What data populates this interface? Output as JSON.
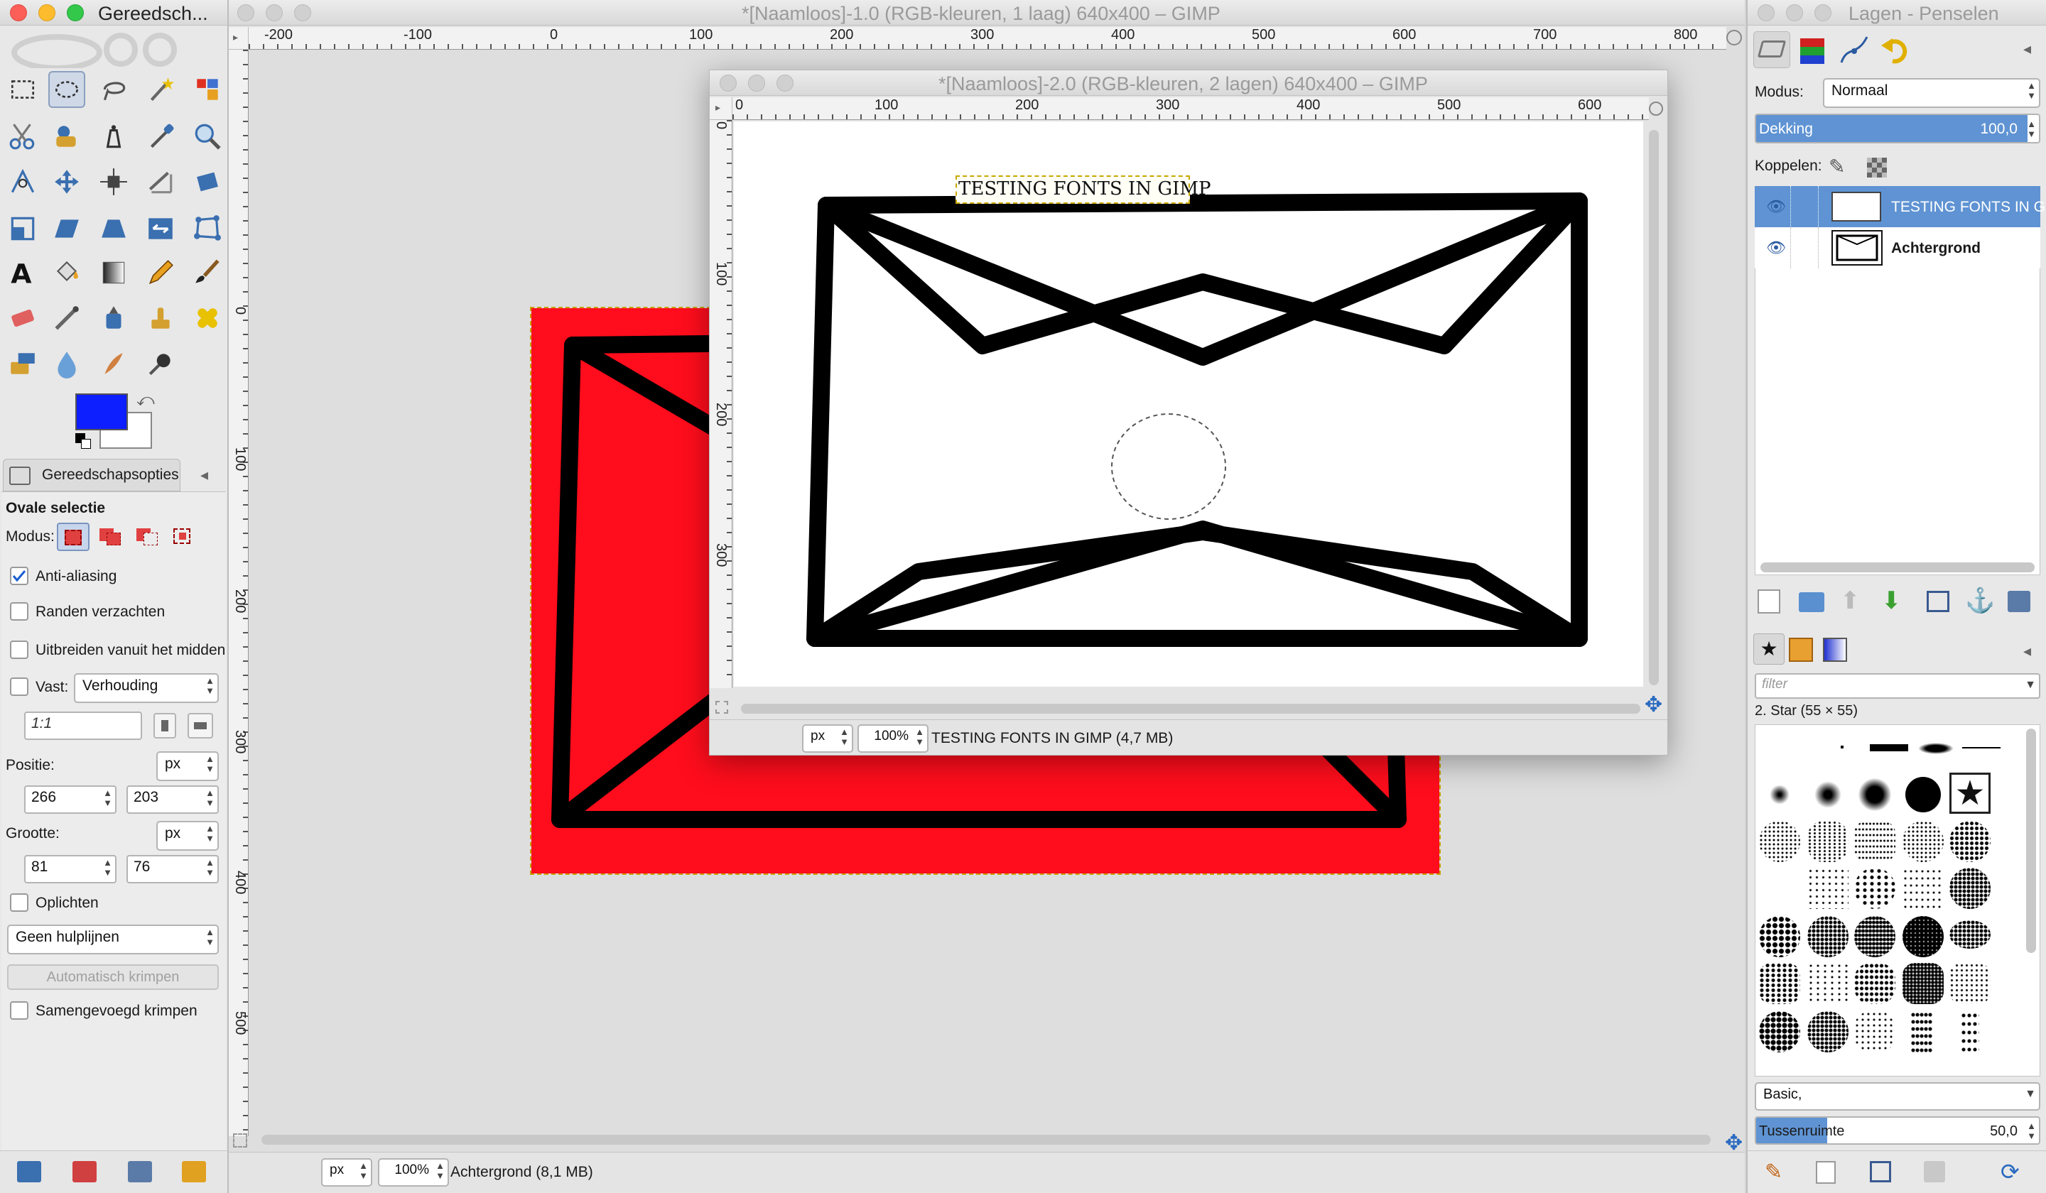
{
  "toolbox": {
    "title": "Gereedsch...",
    "options_tab": "Gereedschapsopties",
    "tool_name": "Ovale selectie",
    "mode_label": "Modus:",
    "antialias_label": "Anti-aliasing",
    "antialias_checked": true,
    "feather_label": "Randen verzachten",
    "expand_label": "Uitbreiden vanuit het midden",
    "fixed_label": "Vast:",
    "fixed_value": "Verhouding",
    "ratio_value": "1:1",
    "position_label": "Positie:",
    "position_unit": "px",
    "position_x": "266",
    "position_y": "203",
    "size_label": "Grootte:",
    "size_unit": "px",
    "size_w": "81",
    "size_h": "76",
    "highlight_label": "Oplichten",
    "guides_value": "Geen hulplijnen",
    "autoshrink_label": "Automatisch krimpen",
    "merged_label": "Samengevoegd krimpen",
    "fg_color": "#0d1eff",
    "bg_color": "#ffffff"
  },
  "main_window": {
    "title": "*[Naamloos]-1.0 (RGB-kleuren, 1 laag) 640x400 – GIMP",
    "ruler_h": [
      "-200",
      "-100",
      "0",
      "100",
      "200",
      "300",
      "400",
      "500",
      "600",
      "700",
      "800"
    ],
    "ruler_v": [
      "0",
      "100",
      "200",
      "300",
      "400",
      "500"
    ],
    "unit": "px",
    "zoom": "100%",
    "status": "Achtergrond (8,1 MB)",
    "canvas_color": "#ff0d1c"
  },
  "image_window": {
    "title": "*[Naamloos]-2.0 (RGB-kleuren, 2 lagen) 640x400 – GIMP",
    "ruler_h": [
      "0",
      "100",
      "200",
      "300",
      "400",
      "500",
      "600"
    ],
    "ruler_v": [
      "0",
      "100",
      "200",
      "300"
    ],
    "text_layer": "TESTING FONTS IN GIMP",
    "unit": "px",
    "zoom": "100%",
    "status": "TESTING FONTS IN GIMP (4,7 MB)"
  },
  "layers": {
    "title": "Lagen - Penselen",
    "mode_label": "Modus:",
    "mode_value": "Normaal",
    "opacity_label": "Dekking",
    "opacity_value": "100,0",
    "lock_label": "Koppelen:",
    "items": [
      {
        "name": "TESTING FONTS IN GIMP",
        "selected": true
      },
      {
        "name": "Achtergrond",
        "selected": false
      }
    ],
    "filter_placeholder": "filter",
    "brush_name": "2. Star (55 × 55)",
    "preset_value": "Basic,",
    "spacing_label": "Tussenruimte",
    "spacing_value": "50,0"
  }
}
